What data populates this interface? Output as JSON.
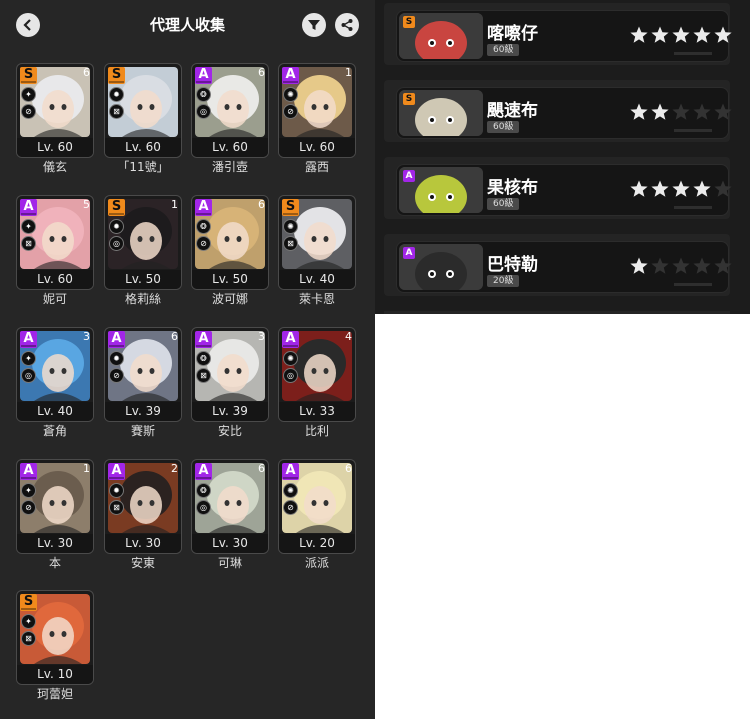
{
  "header": {
    "title": "代理人收集",
    "back_icon": "chevron-left-icon",
    "filter_icon": "filter-icon",
    "share_icon": "share-icon"
  },
  "colors": {
    "rank_S": "#f08a1c",
    "rank_A": "#a226e8",
    "background": "#262626"
  },
  "agents": [
    {
      "name": "儀玄",
      "level": "Lv. 60",
      "rank": "S",
      "mindscape": "6",
      "bg": "#c9c2b5",
      "hair": "#e8e8ea"
    },
    {
      "name": "「11號」",
      "level": "Lv. 60",
      "rank": "S",
      "mindscape": "",
      "bg": "#c3cdd6",
      "hair": "#d9dde3"
    },
    {
      "name": "潘引壺",
      "level": "Lv. 60",
      "rank": "A",
      "mindscape": "6",
      "bg": "#9b9e8e",
      "hair": "#e9e9e6"
    },
    {
      "name": "露西",
      "level": "Lv. 60",
      "rank": "A",
      "mindscape": "1",
      "bg": "#6d5a49",
      "hair": "#e6c989"
    },
    {
      "name": "妮可",
      "level": "Lv. 60",
      "rank": "A",
      "mindscape": "5",
      "bg": "#e3a1a8",
      "hair": "#f0b2bb"
    },
    {
      "name": "格莉絲",
      "level": "Lv. 50",
      "rank": "S",
      "mindscape": "1",
      "bg": "#2b2326",
      "hair": "#1d1b1d"
    },
    {
      "name": "波可娜",
      "level": "Lv. 50",
      "rank": "A",
      "mindscape": "6",
      "bg": "#bfa06c",
      "hair": "#d7b377"
    },
    {
      "name": "萊卡恩",
      "level": "Lv. 40",
      "rank": "S",
      "mindscape": "",
      "bg": "#5e5f63",
      "hair": "#e3e3e6"
    },
    {
      "name": "蒼角",
      "level": "Lv. 40",
      "rank": "A",
      "mindscape": "3",
      "bg": "#3c78b1",
      "hair": "#59a6e2"
    },
    {
      "name": "賽斯",
      "level": "Lv. 39",
      "rank": "A",
      "mindscape": "6",
      "bg": "#6f7585",
      "hair": "#d5d9e2"
    },
    {
      "name": "安比",
      "level": "Lv. 39",
      "rank": "A",
      "mindscape": "3",
      "bg": "#b6b6b2",
      "hair": "#e7e7e5"
    },
    {
      "name": "比利",
      "level": "Lv. 33",
      "rank": "A",
      "mindscape": "4",
      "bg": "#7c1f1b",
      "hair": "#2a2a2a"
    },
    {
      "name": "本",
      "level": "Lv. 30",
      "rank": "A",
      "mindscape": "1",
      "bg": "#8d7e6b",
      "hair": "#6b5d4e"
    },
    {
      "name": "安東",
      "level": "Lv. 30",
      "rank": "A",
      "mindscape": "2",
      "bg": "#7a3b22",
      "hair": "#2b2220"
    },
    {
      "name": "可琳",
      "level": "Lv. 30",
      "rank": "A",
      "mindscape": "6",
      "bg": "#9ea497",
      "hair": "#cfd6c6"
    },
    {
      "name": "派派",
      "level": "Lv. 20",
      "rank": "A",
      "mindscape": "6",
      "bg": "#ddd3a8",
      "hair": "#f0e6b6"
    },
    {
      "name": "珂蕾妲",
      "level": "Lv. 10",
      "rank": "S",
      "mindscape": "",
      "bg": "#c85a37",
      "hair": "#e0683c"
    }
  ],
  "bangboo": [
    {
      "name": "喀嚓仔",
      "level": "60級",
      "rank": "S",
      "stars": 5,
      "color": "#c94540"
    },
    {
      "name": "颶速布",
      "level": "60級",
      "rank": "S",
      "stars": 2,
      "color": "#cfc8b4"
    },
    {
      "name": "果核布",
      "level": "60級",
      "rank": "A",
      "stars": 4,
      "color": "#b8c73c"
    },
    {
      "name": "巴特勒",
      "level": "20級",
      "rank": "A",
      "stars": 1,
      "color": "#2b2b2b"
    }
  ]
}
